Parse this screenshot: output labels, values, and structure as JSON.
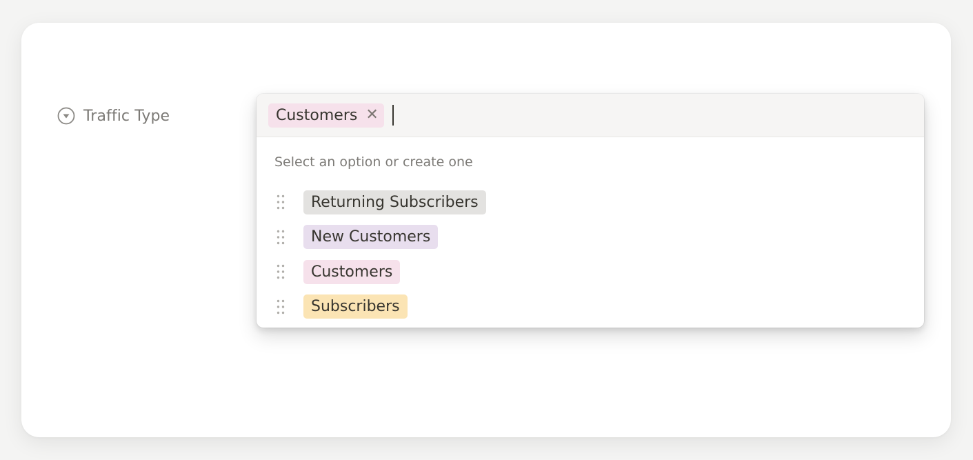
{
  "property": {
    "icon": "circle-chevron-down-icon",
    "label": "Traffic Type"
  },
  "select": {
    "selected": [
      {
        "label": "Customers",
        "color": "#f6e1eb",
        "remove_icon": "close-icon",
        "remove_label": "✕"
      }
    ],
    "hint": "Select an option or create one",
    "options": [
      {
        "label": "Returning Subscribers",
        "color": "#e3e2e0",
        "handle_icon": "drag-handle-icon"
      },
      {
        "label": "New Customers",
        "color": "#e8deee",
        "handle_icon": "drag-handle-icon"
      },
      {
        "label": "Customers",
        "color": "#f6e1eb",
        "handle_icon": "drag-handle-icon"
      },
      {
        "label": "Subscribers",
        "color": "#fbe4b4",
        "handle_icon": "drag-handle-icon"
      }
    ]
  }
}
